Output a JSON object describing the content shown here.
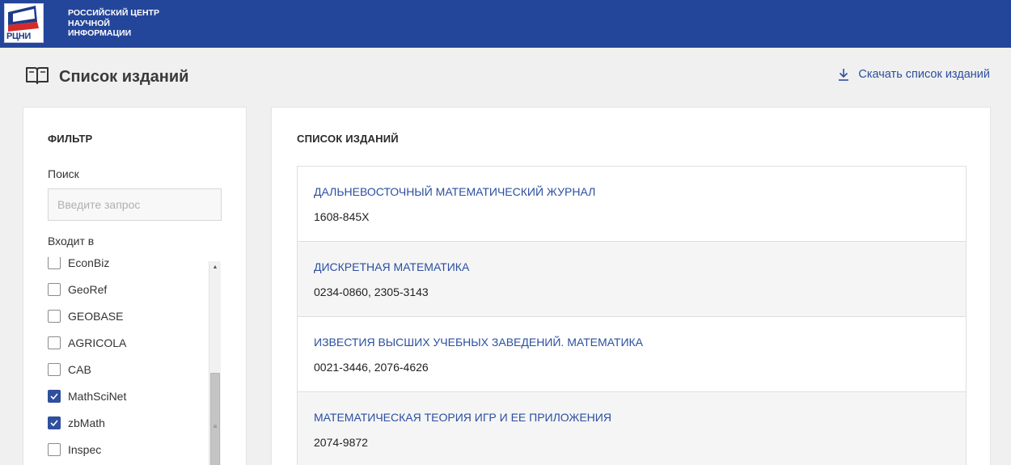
{
  "header": {
    "logo_text": "РЦНИ",
    "org_name": [
      "РОССИЙСКИЙ ЦЕНТР",
      "НАУЧНОЙ",
      "ИНФОРМАЦИИ"
    ]
  },
  "page": {
    "title": "Список изданий",
    "download_label": "Скачать список изданий"
  },
  "filter": {
    "heading": "ФИЛЬТР",
    "search_label": "Поиск",
    "search_placeholder": "Введите запрос",
    "search_value": "",
    "included_label": "Входит в",
    "sources": [
      {
        "label": "EconBiz",
        "checked": false
      },
      {
        "label": "GeoRef",
        "checked": false
      },
      {
        "label": "GEOBASE",
        "checked": false
      },
      {
        "label": "AGRICOLA",
        "checked": false
      },
      {
        "label": "CAB",
        "checked": false
      },
      {
        "label": "MathSciNet",
        "checked": true
      },
      {
        "label": "zbMath",
        "checked": true
      },
      {
        "label": "Inspec",
        "checked": false
      }
    ]
  },
  "list": {
    "heading": "СПИСОК ИЗДАНИЙ",
    "journals": [
      {
        "title": "ДАЛЬНЕВОСТОЧНЫЙ МАТЕМАТИЧЕСКИЙ ЖУРНАЛ",
        "issn": "1608-845X"
      },
      {
        "title": "ДИСКРЕТНАЯ МАТЕМАТИКА",
        "issn": "0234-0860, 2305-3143"
      },
      {
        "title": "ИЗВЕСТИЯ ВЫСШИХ УЧЕБНЫХ ЗАВЕДЕНИЙ. МАТЕМАТИКА",
        "issn": "0021-3446, 2076-4626"
      },
      {
        "title": "МАТЕМАТИЧЕСКАЯ ТЕОРИЯ ИГР И ЕЕ ПРИЛОЖЕНИЯ",
        "issn": "2074-9872"
      }
    ]
  },
  "colors": {
    "header_bg": "#24469a",
    "accent": "#2b4fa0",
    "checkbox_checked": "#2f4f9f"
  },
  "icons": {
    "book": "open-book-icon",
    "download": "download-arrow-icon",
    "check": "checkmark-icon"
  }
}
